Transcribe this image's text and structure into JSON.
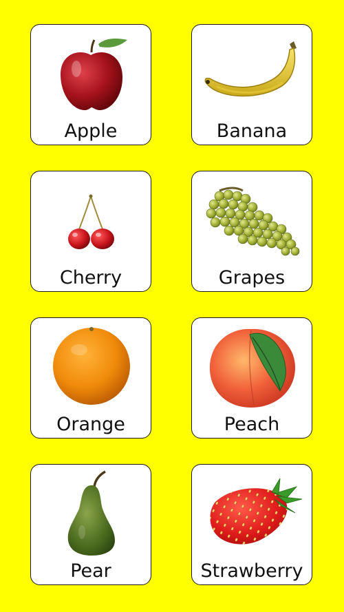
{
  "colors": {
    "background": "#FFFF00",
    "card": "#FFFFFF",
    "border": "#1A1A1A"
  },
  "fruits": [
    {
      "label": "Apple",
      "icon": "apple-icon"
    },
    {
      "label": "Banana",
      "icon": "banana-icon"
    },
    {
      "label": "Cherry",
      "icon": "cherry-icon"
    },
    {
      "label": "Grapes",
      "icon": "grapes-icon"
    },
    {
      "label": "Orange",
      "icon": "orange-icon"
    },
    {
      "label": "Peach",
      "icon": "peach-icon"
    },
    {
      "label": "Pear",
      "icon": "pear-icon"
    },
    {
      "label": "Strawberry",
      "icon": "strawberry-icon"
    }
  ]
}
